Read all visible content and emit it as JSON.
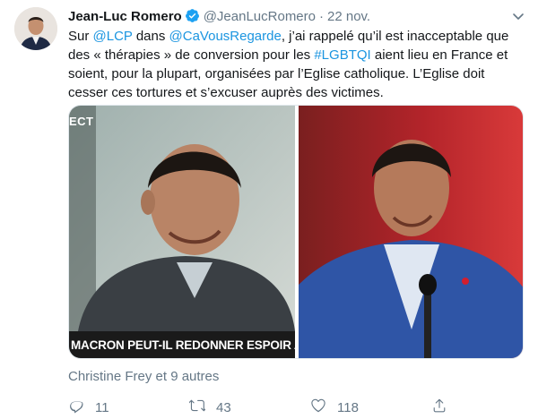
{
  "author": {
    "name": "Jean-Luc Romero",
    "handle": "@JeanLucRomero",
    "separator": "·",
    "date": "22 nov."
  },
  "tweet": {
    "t1": "Sur ",
    "m1": "@LCP",
    "t2": " dans ",
    "m2": "@CaVousRegarde",
    "t3": ", j’ai rappelé qu’il est inacceptable que des « thérapies » de conversion pour les ",
    "h1": "#LGBTQI",
    "t4": " aient lieu en France et soient, pour la plupart, organisées par l’Eglise catholique. L’Eglise doit cesser ces tortures et s’excuser auprès des victimes."
  },
  "media": {
    "left_tag": "ECT",
    "left_caption": "MACRON PEUT-IL REDONNER ESPOIR AUX JEUNI"
  },
  "liked_by": "Christine Frey et 9 autres",
  "actions": {
    "reply_count": "11",
    "retweet_count": "43",
    "like_count": "118"
  },
  "colors": {
    "link": "#1b95e0",
    "secondary_text": "#657786",
    "verified": "#1da1f2"
  },
  "icons": [
    "verified-badge-icon",
    "chevron-down-icon",
    "reply-icon",
    "retweet-icon",
    "like-icon",
    "share-icon"
  ]
}
